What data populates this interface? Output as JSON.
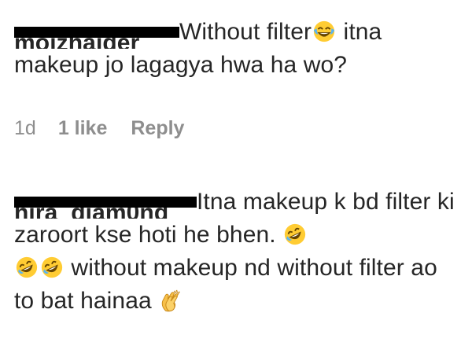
{
  "comments": [
    {
      "username": "moizhaider",
      "text_parts": [
        "Without filter",
        " itna makeup jo lagagya hwa ha wo?"
      ],
      "emoji": [
        "face-with-tears-of-joy-icon"
      ],
      "meta": {
        "time": "1d",
        "likes": "1 like",
        "reply": "Reply"
      }
    },
    {
      "username": "hira_diam0nd",
      "text_parts": [
        "Itna makeup k bd filter ki zaroort kse hoti he bhen. ",
        " without makeup nd without filter ao to bat hainaa "
      ],
      "emoji": [
        "rolling-on-floor-laughing-icon",
        "rolling-on-floor-laughing-icon",
        "rolling-on-floor-laughing-icon",
        "clapping-hands-icon"
      ]
    }
  ],
  "colors": {
    "text": "#262626",
    "meta": "#8e8e8e",
    "redaction": "#000000",
    "emoji_face": "#FFCC33",
    "emoji_tear": "#5AB4F0",
    "emoji_hands": "#F7C04A"
  }
}
